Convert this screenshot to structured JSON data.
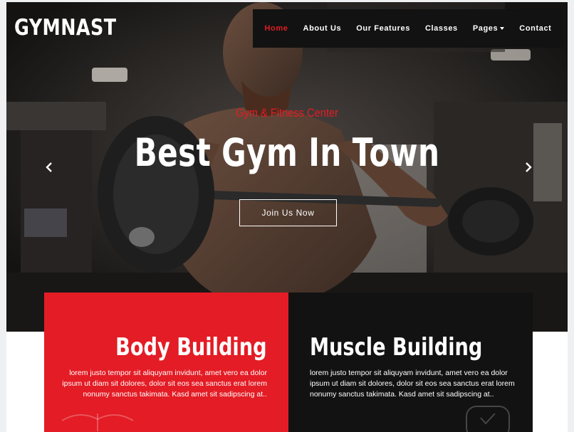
{
  "brand": {
    "name": "GYMNAST"
  },
  "nav": {
    "items": [
      {
        "label": "Home",
        "active": true
      },
      {
        "label": "About Us"
      },
      {
        "label": "Our Features"
      },
      {
        "label": "Classes"
      },
      {
        "label": "Pages",
        "dropdown": true
      },
      {
        "label": "Contact"
      }
    ]
  },
  "hero": {
    "subtitle": "Gym & Fitness Center",
    "title": "Best Gym In Town",
    "cta_label": "Join Us Now",
    "prev_icon": "chevron-left-icon",
    "next_icon": "chevron-right-icon"
  },
  "features": [
    {
      "title": "Body Building",
      "text": "lorem justo tempor sit aliquyam invidunt, amet vero ea dolor ipsum ut diam sit dolores, dolor sit eos sea sanctus erat lorem nonumy sanctus takimata. Kasd amet sit sadipscing at..",
      "background": "#e31c25"
    },
    {
      "title": "Muscle Building",
      "text": "lorem justo tempor sit aliquyam invidunt, amet vero ea dolor ipsum ut diam sit dolores, dolor sit eos sea sanctus erat lorem nonumy sanctus takimata. Kasd amet sit sadipscing at..",
      "background": "#121212"
    }
  ],
  "colors": {
    "accent": "#e31c25",
    "dark": "#121212",
    "white": "#ffffff"
  }
}
